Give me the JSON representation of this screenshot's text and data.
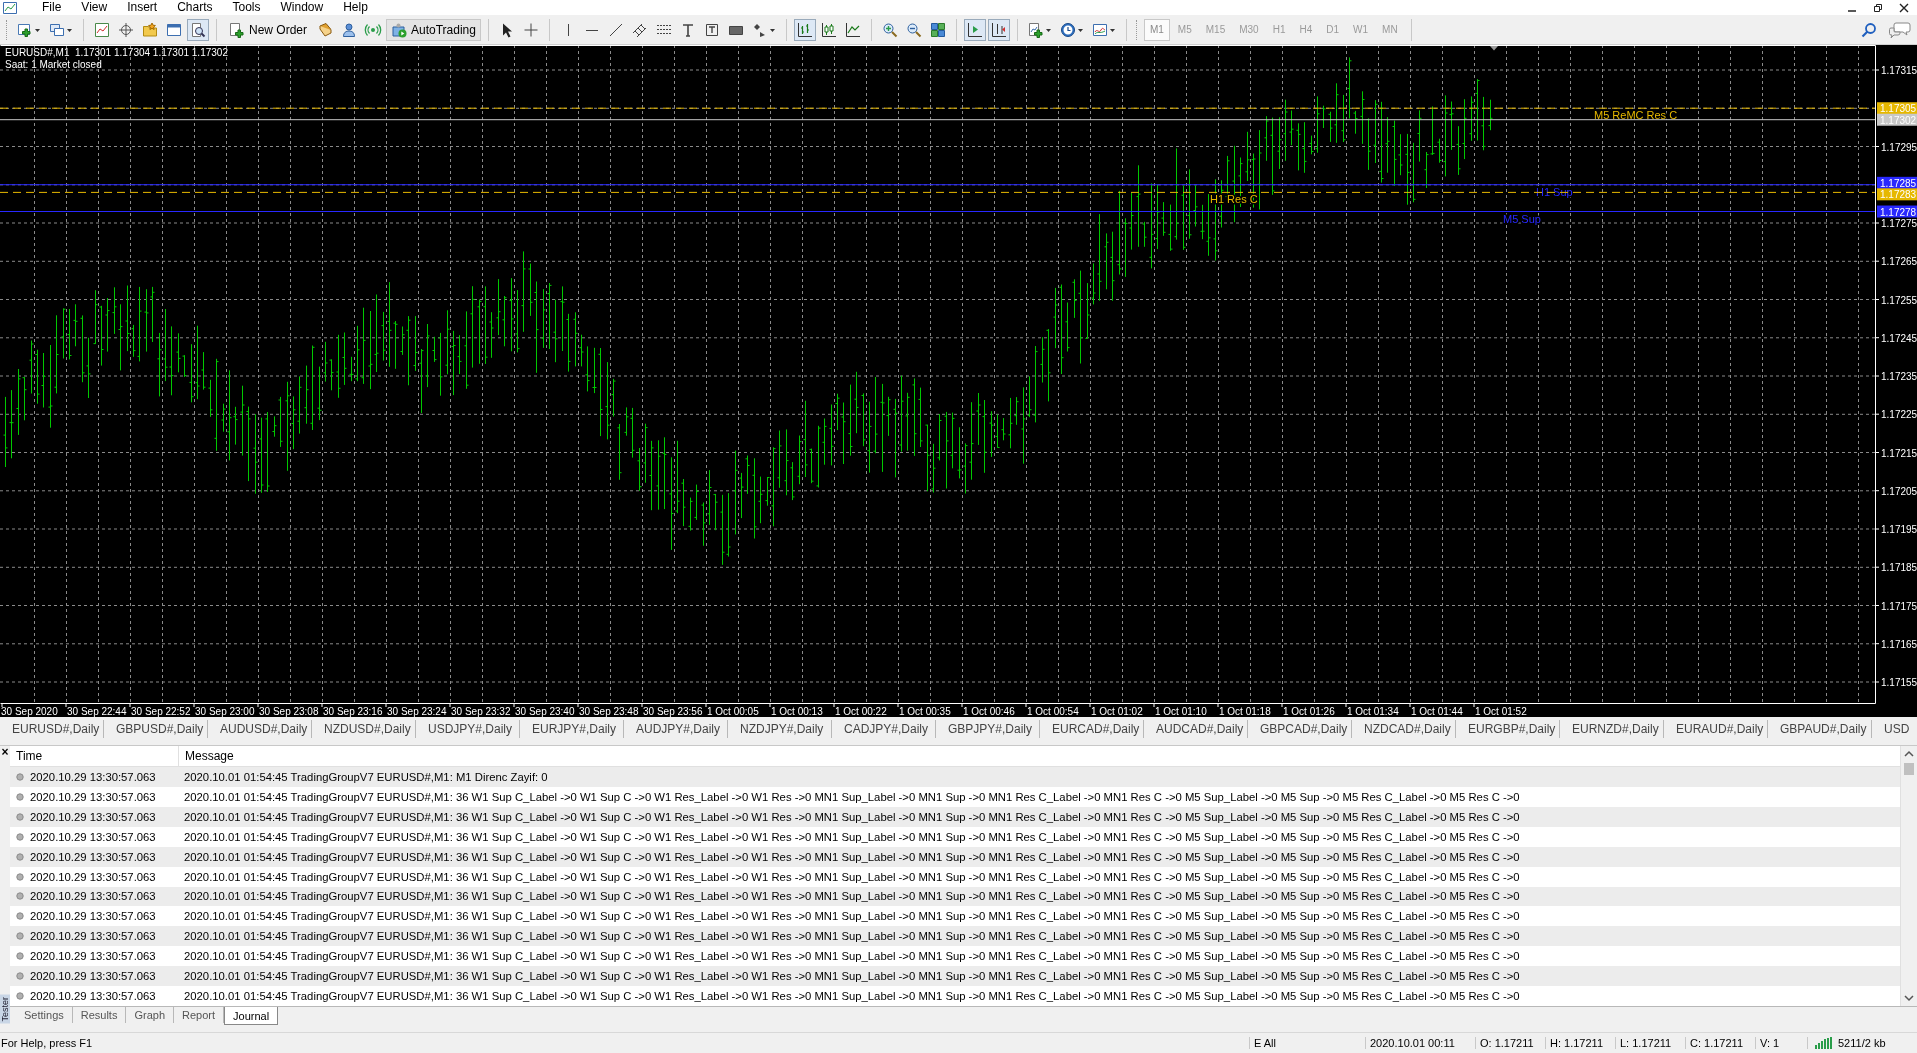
{
  "menu": [
    "File",
    "View",
    "Insert",
    "Charts",
    "Tools",
    "Window",
    "Help"
  ],
  "toolbar": [
    {
      "kind": "icon",
      "pressed": false
    },
    {
      "kind": "icon",
      "pressed": false
    },
    {
      "kind": "icon",
      "pressed": false
    },
    {
      "kind": "icon",
      "pressed": false
    },
    {
      "kind": "icon",
      "pressed": false
    },
    {
      "kind": "icon",
      "pressed": false
    },
    {
      "kind": "icon",
      "pressed": true
    },
    {
      "kind": "button",
      "label": "New Order",
      "pressed": false
    },
    {
      "kind": "icon",
      "pressed": false
    },
    {
      "kind": "icon",
      "pressed": false
    },
    {
      "kind": "icon",
      "pressed": false
    },
    {
      "kind": "button",
      "label": "AutoTrading",
      "pressed": true
    },
    {
      "kind": "icon",
      "pressed": false
    },
    {
      "kind": "icon",
      "pressed": false
    },
    {
      "kind": "icon",
      "pressed": false
    },
    {
      "kind": "icon",
      "pressed": false
    },
    {
      "kind": "icon",
      "pressed": false
    },
    {
      "kind": "icon",
      "pressed": false
    },
    {
      "kind": "icon",
      "pressed": false
    },
    {
      "kind": "icon",
      "pressed": false
    },
    {
      "kind": "icon",
      "pressed": false
    },
    {
      "kind": "icon",
      "pressed": false
    },
    {
      "kind": "icon",
      "pressed": false
    },
    {
      "kind": "icon",
      "pressed": true
    },
    {
      "kind": "icon",
      "pressed": false
    },
    {
      "kind": "icon",
      "pressed": false
    },
    {
      "kind": "icon",
      "pressed": false
    },
    {
      "kind": "icon",
      "pressed": false
    },
    {
      "kind": "icon",
      "pressed": false
    },
    {
      "kind": "icon",
      "pressed": true
    },
    {
      "kind": "icon",
      "pressed": true
    },
    {
      "kind": "icon",
      "pressed": false
    },
    {
      "kind": "icon",
      "pressed": false
    },
    {
      "kind": "icon",
      "pressed": false
    }
  ],
  "timeframes": [
    {
      "label": "M1",
      "selected": true
    },
    {
      "label": "M5",
      "selected": false
    },
    {
      "label": "M15",
      "selected": false
    },
    {
      "label": "M30",
      "selected": false
    },
    {
      "label": "H1",
      "selected": false
    },
    {
      "label": "H4",
      "selected": false
    },
    {
      "label": "D1",
      "selected": false
    },
    {
      "label": "W1",
      "selected": false
    },
    {
      "label": "MN",
      "selected": false
    }
  ],
  "chart": {
    "header": "EURUSD#,M1  1.17301 1.17304 1.17301 1.17302",
    "status_text": "Saat: 1 Market closed",
    "time_axis": [
      "30 Sep 2020",
      "30 Sep 22:44",
      "30 Sep 22:52",
      "30 Sep 23:00",
      "30 Sep 23:08",
      "30 Sep 23:16",
      "30 Sep 23:24",
      "30 Sep 23:32",
      "30 Sep 23:40",
      "30 Sep 23:48",
      "30 Sep 23:56",
      "1 Oct 00:05",
      "1 Oct 00:13",
      "1 Oct 00:22",
      "1 Oct 00:35",
      "1 Oct 00:46",
      "1 Oct 00:54",
      "1 Oct 01:02",
      "1 Oct 01:10",
      "1 Oct 01:18",
      "1 Oct 01:26",
      "1 Oct 01:34",
      "1 Oct 01:44",
      "1 Oct 01:52"
    ],
    "price_axis": [
      "1.17315",
      "1.17295",
      "1.17275",
      "1.17265",
      "1.17255",
      "1.17245",
      "1.17235",
      "1.17225",
      "1.17215",
      "1.17205",
      "1.17195",
      "1.17185",
      "1.17175",
      "1.17165",
      "1.17155"
    ],
    "levels": [
      {
        "kind": "dashed",
        "tag": "1.17305",
        "label": "M5 ReMC Res C",
        "color": "#e6b800"
      },
      {
        "kind": "solid",
        "tag": "1.17302",
        "color": "#c8c8c8"
      },
      {
        "kind": "solid",
        "tag": "1.17285",
        "label": "H1 Sup",
        "color": "#2828ff"
      },
      {
        "kind": "dashed",
        "tag": "1.17283",
        "label": "H1 Res C",
        "color": "#e6b800"
      },
      {
        "kind": "solid",
        "tag": "1.17278",
        "label": "M5 Sup",
        "color": "#2828ff"
      }
    ]
  },
  "symbol_tabs": [
    {
      "label": "EURUSD#,Daily",
      "selected": false
    },
    {
      "label": "GBPUSD#,Daily",
      "selected": false
    },
    {
      "label": "AUDUSD#,Daily",
      "selected": false
    },
    {
      "label": "NZDUSD#,Daily",
      "selected": false
    },
    {
      "label": "USDJPY#,Daily",
      "selected": false
    },
    {
      "label": "EURJPY#,Daily",
      "selected": false
    },
    {
      "label": "AUDJPY#,Daily",
      "selected": false
    },
    {
      "label": "NZDJPY#,Daily",
      "selected": false
    },
    {
      "label": "CADJPY#,Daily",
      "selected": false
    },
    {
      "label": "GBPJPY#,Daily",
      "selected": false
    },
    {
      "label": "EURCAD#,Daily",
      "selected": false
    },
    {
      "label": "AUDCAD#,Daily",
      "selected": false
    },
    {
      "label": "GBPCAD#,Daily",
      "selected": false
    },
    {
      "label": "NZDCAD#,Daily",
      "selected": false
    },
    {
      "label": "EURGBP#,Daily",
      "selected": false
    },
    {
      "label": "EURNZD#,Daily",
      "selected": false
    },
    {
      "label": "EURAUD#,Daily",
      "selected": false
    },
    {
      "label": "GBPAUD#,Daily",
      "selected": false
    },
    {
      "label": "USD",
      "selected": false
    }
  ],
  "tester": {
    "close": "×",
    "side_label": "Tester",
    "columns": [
      "Time",
      "Message"
    ],
    "rows": [
      {
        "time": "2020.10.29 13:30:57.063",
        "message": "2020.10.01 01:54:45  TradingGroupV7 EURUSD#,M1: M1 Direnc Zayif: 0"
      },
      {
        "time": "2020.10.29 13:30:57.063",
        "message": "2020.10.01 01:54:45  TradingGroupV7 EURUSD#,M1: 36 W1 Sup C_Label ->0 W1 Sup C ->0 W1 Res_Label ->0 W1 Res ->0 MN1 Sup_Label ->0 MN1 Sup ->0 MN1 Res C_Label ->0 MN1 Res C ->0 M5 Sup_Label ->0 M5 Sup ->0 M5 Res C_Label ->0 M5 Res C ->0"
      },
      {
        "time": "2020.10.29 13:30:57.063",
        "message": "2020.10.01 01:54:45  TradingGroupV7 EURUSD#,M1: 36 W1 Sup C_Label ->0 W1 Sup C ->0 W1 Res_Label ->0 W1 Res ->0 MN1 Sup_Label ->0 MN1 Sup ->0 MN1 Res C_Label ->0 MN1 Res C ->0 M5 Sup_Label ->0 M5 Sup ->0 M5 Res C_Label ->0 M5 Res C ->0"
      },
      {
        "time": "2020.10.29 13:30:57.063",
        "message": "2020.10.01 01:54:45  TradingGroupV7 EURUSD#,M1: 36 W1 Sup C_Label ->0 W1 Sup C ->0 W1 Res_Label ->0 W1 Res ->0 MN1 Sup_Label ->0 MN1 Sup ->0 MN1 Res C_Label ->0 MN1 Res C ->0 M5 Sup_Label ->0 M5 Sup ->0 M5 Res C_Label ->0 M5 Res C ->0"
      },
      {
        "time": "2020.10.29 13:30:57.063",
        "message": "2020.10.01 01:54:45  TradingGroupV7 EURUSD#,M1: 36 W1 Sup C_Label ->0 W1 Sup C ->0 W1 Res_Label ->0 W1 Res ->0 MN1 Sup_Label ->0 MN1 Sup ->0 MN1 Res C_Label ->0 MN1 Res C ->0 M5 Sup_Label ->0 M5 Sup ->0 M5 Res C_Label ->0 M5 Res C ->0"
      },
      {
        "time": "2020.10.29 13:30:57.063",
        "message": "2020.10.01 01:54:45  TradingGroupV7 EURUSD#,M1: 36 W1 Sup C_Label ->0 W1 Sup C ->0 W1 Res_Label ->0 W1 Res ->0 MN1 Sup_Label ->0 MN1 Sup ->0 MN1 Res C_Label ->0 MN1 Res C ->0 M5 Sup_Label ->0 M5 Sup ->0 M5 Res C_Label ->0 M5 Res C ->0"
      },
      {
        "time": "2020.10.29 13:30:57.063",
        "message": "2020.10.01 01:54:45  TradingGroupV7 EURUSD#,M1: 36 W1 Sup C_Label ->0 W1 Sup C ->0 W1 Res_Label ->0 W1 Res ->0 MN1 Sup_Label ->0 MN1 Sup ->0 MN1 Res C_Label ->0 MN1 Res C ->0 M5 Sup_Label ->0 M5 Sup ->0 M5 Res C_Label ->0 M5 Res C ->0"
      },
      {
        "time": "2020.10.29 13:30:57.063",
        "message": "2020.10.01 01:54:45  TradingGroupV7 EURUSD#,M1: 36 W1 Sup C_Label ->0 W1 Sup C ->0 W1 Res_Label ->0 W1 Res ->0 MN1 Sup_Label ->0 MN1 Sup ->0 MN1 Res C_Label ->0 MN1 Res C ->0 M5 Sup_Label ->0 M5 Sup ->0 M5 Res C_Label ->0 M5 Res C ->0"
      },
      {
        "time": "2020.10.29 13:30:57.063",
        "message": "2020.10.01 01:54:45  TradingGroupV7 EURUSD#,M1: 36 W1 Sup C_Label ->0 W1 Sup C ->0 W1 Res_Label ->0 W1 Res ->0 MN1 Sup_Label ->0 MN1 Sup ->0 MN1 Res C_Label ->0 MN1 Res C ->0 M5 Sup_Label ->0 M5 Sup ->0 M5 Res C_Label ->0 M5 Res C ->0"
      },
      {
        "time": "2020.10.29 13:30:57.063",
        "message": "2020.10.01 01:54:45  TradingGroupV7 EURUSD#,M1: 36 W1 Sup C_Label ->0 W1 Sup C ->0 W1 Res_Label ->0 W1 Res ->0 MN1 Sup_Label ->0 MN1 Sup ->0 MN1 Res C_Label ->0 MN1 Res C ->0 M5 Sup_Label ->0 M5 Sup ->0 M5 Res C_Label ->0 M5 Res C ->0"
      },
      {
        "time": "2020.10.29 13:30:57.063",
        "message": "2020.10.01 01:54:45  TradingGroupV7 EURUSD#,M1: 36 W1 Sup C_Label ->0 W1 Sup C ->0 W1 Res_Label ->0 W1 Res ->0 MN1 Sup_Label ->0 MN1 Sup ->0 MN1 Res C_Label ->0 MN1 Res C ->0 M5 Sup_Label ->0 M5 Sup ->0 M5 Res C_Label ->0 M5 Res C ->0"
      },
      {
        "time": "2020.10.29 13:30:57.063",
        "message": "2020.10.01 01:54:45  TradingGroupV7 EURUSD#,M1: 36 W1 Sup C_Label ->0 W1 Sup C ->0 W1 Res_Label ->0 W1 Res ->0 MN1 Sup_Label ->0 MN1 Sup ->0 MN1 Res C_Label ->0 MN1 Res C ->0 M5 Sup_Label ->0 M5 Sup ->0 M5 Res C_Label ->0 M5 Res C ->0"
      }
    ],
    "tabs": [
      {
        "label": "Settings",
        "selected": false
      },
      {
        "label": "Results",
        "selected": false
      },
      {
        "label": "Graph",
        "selected": false
      },
      {
        "label": "Report",
        "selected": false
      },
      {
        "label": "Journal",
        "selected": true
      }
    ]
  },
  "status_bar": {
    "help": "For Help, press F1",
    "fields": [
      "E All",
      "2020.10.01 00:11",
      "O: 1.17211",
      "H: 1.17211",
      "L: 1.17211",
      "C: 1.17211",
      "V: 1"
    ],
    "traffic": "5211/2 kb"
  }
}
